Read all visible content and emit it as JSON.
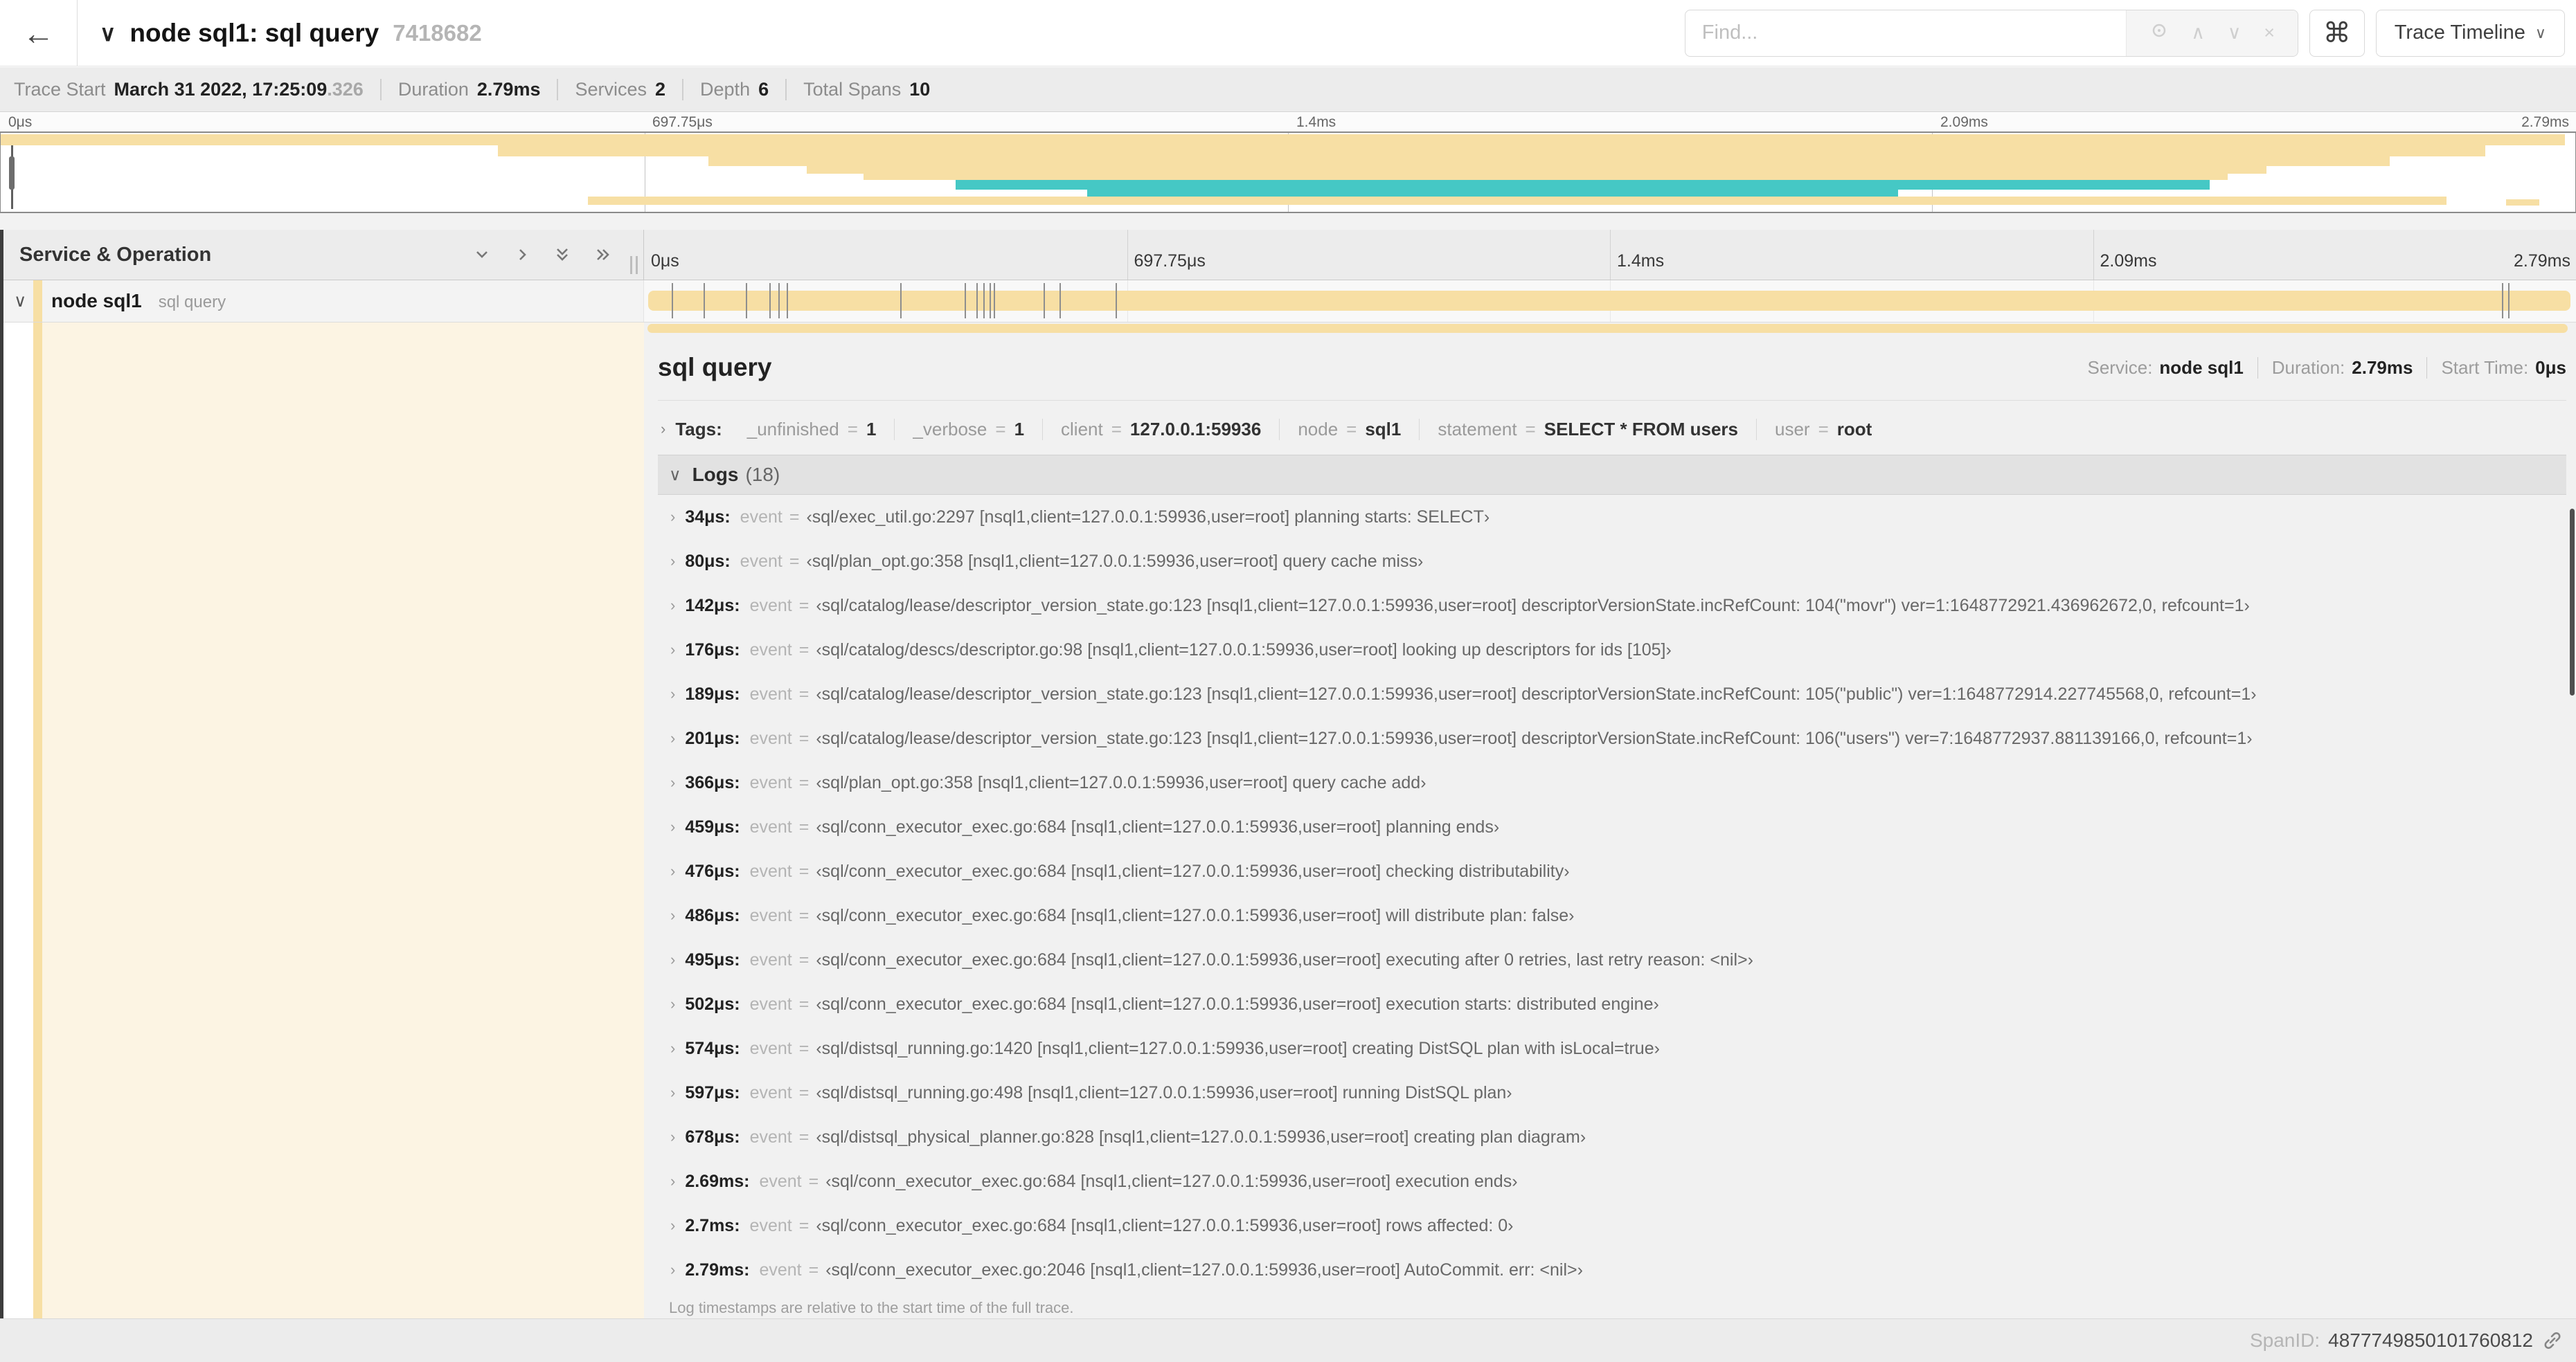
{
  "icons": {
    "back": "←",
    "collapse": "∨",
    "prev": "∧",
    "next": "∨",
    "clear": "×",
    "cmd": "⌘",
    "dd_caret": "∨",
    "row_caret": "∨",
    "section_caret": "›",
    "logs_caret": "∨",
    "log_row_caret": "›"
  },
  "header": {
    "title": "node sql1: sql query",
    "trace_id": "7418682",
    "find_placeholder": "Find...",
    "view_selector": "Trace Timeline"
  },
  "summary": {
    "items": [
      {
        "label": "Trace Start",
        "value": "March 31 2022, 17:25:09",
        "suffix": ".326"
      },
      {
        "label": "Duration",
        "value": "2.79ms",
        "suffix": ""
      },
      {
        "label": "Services",
        "value": "2",
        "suffix": ""
      },
      {
        "label": "Depth",
        "value": "6",
        "suffix": ""
      },
      {
        "label": "Total Spans",
        "value": "10",
        "suffix": ""
      }
    ]
  },
  "timeline": {
    "duration_us": 2790,
    "ticks": [
      "0μs",
      "697.75μs",
      "1.4ms",
      "2.09ms",
      "2.79ms"
    ],
    "colors": {
      "tan": "#f7dfa4",
      "teal": "#45c8c5"
    },
    "minimap_bars": [
      {
        "l": 0,
        "w": 99.6,
        "t": 2,
        "h": 14,
        "c": "tan"
      },
      {
        "l": 19.3,
        "w": 77.2,
        "t": 16,
        "h": 14,
        "c": "tan"
      },
      {
        "l": 27.5,
        "w": 65.3,
        "t": 30,
        "h": 12,
        "c": "tan"
      },
      {
        "l": 31.3,
        "w": 56.7,
        "t": 42,
        "h": 10,
        "c": "tan"
      },
      {
        "l": 33.5,
        "w": 53.0,
        "t": 52,
        "h": 8,
        "c": "tan"
      },
      {
        "l": 37.1,
        "w": 48.7,
        "t": 60,
        "h": 12,
        "c": "teal"
      },
      {
        "l": 42.2,
        "w": 31.5,
        "t": 72,
        "h": 9,
        "c": "teal"
      },
      {
        "l": 22.8,
        "w": 72.2,
        "t": 81,
        "h": 10,
        "c": "tan"
      },
      {
        "l": 97.3,
        "w": 1.3,
        "t": 84,
        "h": 8,
        "c": "tan"
      }
    ]
  },
  "span_table": {
    "header": "Service & Operation",
    "row": {
      "service": "node sql1",
      "operation": "sql query"
    }
  },
  "detail": {
    "title": "sql query",
    "meta": [
      {
        "label": "Service:",
        "value": "node sql1"
      },
      {
        "label": "Duration:",
        "value": "2.79ms"
      },
      {
        "label": "Start Time:",
        "value": "0μs"
      }
    ],
    "tags_label": "Tags:",
    "eq": "=",
    "tags": [
      {
        "key": "_unfinished",
        "value": "1"
      },
      {
        "key": "_verbose",
        "value": "1"
      },
      {
        "key": "client",
        "value": "127.0.0.1:59936"
      },
      {
        "key": "node",
        "value": "sql1"
      },
      {
        "key": "statement",
        "value": "SELECT * FROM users"
      },
      {
        "key": "user",
        "value": "root"
      }
    ],
    "logs_label": "Logs",
    "logs_count": "(18)",
    "logs_key": "event",
    "logs": [
      {
        "t": "34μs:",
        "t_us": 34,
        "msg": "‹sql/exec_util.go:2297 [nsql1,client=127.0.0.1:59936,user=root] planning starts: SELECT›"
      },
      {
        "t": "80μs:",
        "t_us": 80,
        "msg": "‹sql/plan_opt.go:358 [nsql1,client=127.0.0.1:59936,user=root] query cache miss›"
      },
      {
        "t": "142μs:",
        "t_us": 142,
        "msg": "‹sql/catalog/lease/descriptor_version_state.go:123 [nsql1,client=127.0.0.1:59936,user=root] descriptorVersionState.incRefCount: 104(\"movr\") ver=1:1648772921.436962672,0, refcount=1›"
      },
      {
        "t": "176μs:",
        "t_us": 176,
        "msg": "‹sql/catalog/descs/descriptor.go:98 [nsql1,client=127.0.0.1:59936,user=root] looking up descriptors for ids [105]›"
      },
      {
        "t": "189μs:",
        "t_us": 189,
        "msg": "‹sql/catalog/lease/descriptor_version_state.go:123 [nsql1,client=127.0.0.1:59936,user=root] descriptorVersionState.incRefCount: 105(\"public\") ver=1:1648772914.227745568,0, refcount=1›"
      },
      {
        "t": "201μs:",
        "t_us": 201,
        "msg": "‹sql/catalog/lease/descriptor_version_state.go:123 [nsql1,client=127.0.0.1:59936,user=root] descriptorVersionState.incRefCount: 106(\"users\") ver=7:1648772937.881139166,0, refcount=1›"
      },
      {
        "t": "366μs:",
        "t_us": 366,
        "msg": "‹sql/plan_opt.go:358 [nsql1,client=127.0.0.1:59936,user=root] query cache add›"
      },
      {
        "t": "459μs:",
        "t_us": 459,
        "msg": "‹sql/conn_executor_exec.go:684 [nsql1,client=127.0.0.1:59936,user=root] planning ends›"
      },
      {
        "t": "476μs:",
        "t_us": 476,
        "msg": "‹sql/conn_executor_exec.go:684 [nsql1,client=127.0.0.1:59936,user=root] checking distributability›"
      },
      {
        "t": "486μs:",
        "t_us": 486,
        "msg": "‹sql/conn_executor_exec.go:684 [nsql1,client=127.0.0.1:59936,user=root] will distribute plan: false›"
      },
      {
        "t": "495μs:",
        "t_us": 495,
        "msg": "‹sql/conn_executor_exec.go:684 [nsql1,client=127.0.0.1:59936,user=root] executing after 0 retries, last retry reason: <nil>›"
      },
      {
        "t": "502μs:",
        "t_us": 502,
        "msg": "‹sql/conn_executor_exec.go:684 [nsql1,client=127.0.0.1:59936,user=root] execution starts: distributed engine›"
      },
      {
        "t": "574μs:",
        "t_us": 574,
        "msg": "‹sql/distsql_running.go:1420 [nsql1,client=127.0.0.1:59936,user=root] creating DistSQL plan with isLocal=true›"
      },
      {
        "t": "597μs:",
        "t_us": 597,
        "msg": "‹sql/distsql_running.go:498 [nsql1,client=127.0.0.1:59936,user=root] running DistSQL plan›"
      },
      {
        "t": "678μs:",
        "t_us": 678,
        "msg": "‹sql/distsql_physical_planner.go:828 [nsql1,client=127.0.0.1:59936,user=root] creating plan diagram›"
      },
      {
        "t": "2.69ms:",
        "t_us": 2690,
        "msg": "‹sql/conn_executor_exec.go:684 [nsql1,client=127.0.0.1:59936,user=root] execution ends›"
      },
      {
        "t": "2.7ms:",
        "t_us": 2700,
        "msg": "‹sql/conn_executor_exec.go:684 [nsql1,client=127.0.0.1:59936,user=root] rows affected: 0›"
      },
      {
        "t": "2.79ms:",
        "t_us": 2790,
        "msg": "‹sql/conn_executor_exec.go:2046 [nsql1,client=127.0.0.1:59936,user=root] AutoCommit. err: <nil>›"
      }
    ],
    "logs_footer": "Log timestamps are relative to the start time of the full trace.",
    "span_id_label": "SpanID:",
    "span_id": "4877749850101760812"
  }
}
